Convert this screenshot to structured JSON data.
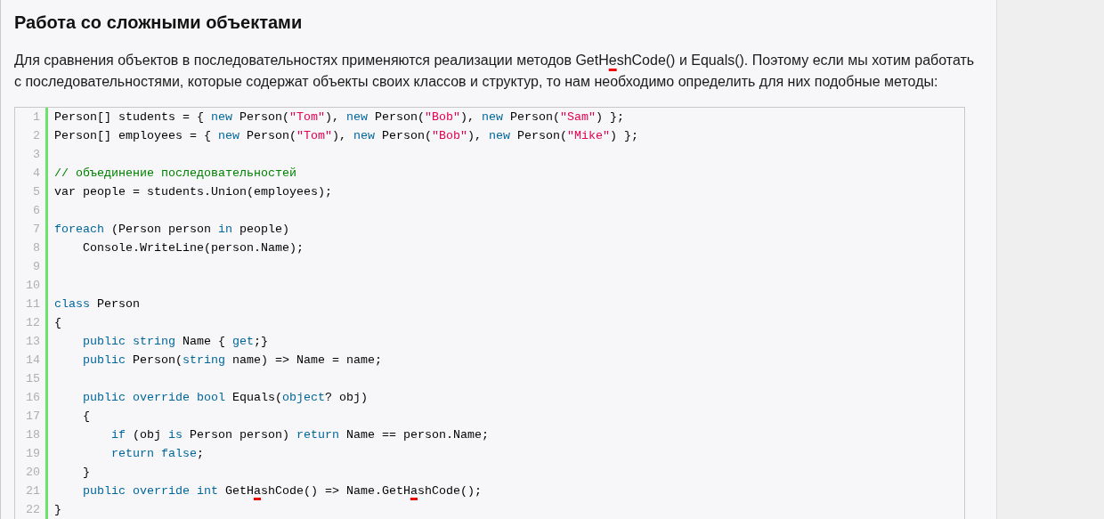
{
  "article": {
    "heading": "Работа со сложными объектами",
    "paragraph": [
      {
        "kind": "plain",
        "text": "Для сравнения объектов в последовательностях применяются реализации методов GetH"
      },
      {
        "kind": "underlined",
        "text": "e"
      },
      {
        "kind": "plain",
        "text": "shCode() и Equals(). Поэтому если мы хотим работать с последовательностями, которые содержат объекты своих классов и структур, то нам необходимо определить для них подобные методы:"
      }
    ],
    "code": [
      {
        "number": "1",
        "tokens": [
          {
            "kind": "plain",
            "text": "Person[] students = { "
          },
          {
            "kind": "keyword",
            "text": "new"
          },
          {
            "kind": "plain",
            "text": " Person("
          },
          {
            "kind": "string",
            "text": "\"Tom\""
          },
          {
            "kind": "plain",
            "text": "), "
          },
          {
            "kind": "keyword",
            "text": "new"
          },
          {
            "kind": "plain",
            "text": " Person("
          },
          {
            "kind": "string",
            "text": "\"Bob\""
          },
          {
            "kind": "plain",
            "text": "), "
          },
          {
            "kind": "keyword",
            "text": "new"
          },
          {
            "kind": "plain",
            "text": " Person("
          },
          {
            "kind": "string",
            "text": "\"Sam\""
          },
          {
            "kind": "plain",
            "text": ") };"
          }
        ]
      },
      {
        "number": "2",
        "tokens": [
          {
            "kind": "plain",
            "text": "Person[] employees = { "
          },
          {
            "kind": "keyword",
            "text": "new"
          },
          {
            "kind": "plain",
            "text": " Person("
          },
          {
            "kind": "string",
            "text": "\"Tom\""
          },
          {
            "kind": "plain",
            "text": "), "
          },
          {
            "kind": "keyword",
            "text": "new"
          },
          {
            "kind": "plain",
            "text": " Person("
          },
          {
            "kind": "string",
            "text": "\"Bob\""
          },
          {
            "kind": "plain",
            "text": "), "
          },
          {
            "kind": "keyword",
            "text": "new"
          },
          {
            "kind": "plain",
            "text": " Person("
          },
          {
            "kind": "string",
            "text": "\"Mike\""
          },
          {
            "kind": "plain",
            "text": ") };"
          }
        ]
      },
      {
        "number": "3"
      },
      {
        "number": "4",
        "tokens": [
          {
            "kind": "comment",
            "text": "// объединение последовательностей"
          }
        ]
      },
      {
        "number": "5",
        "tokens": [
          {
            "kind": "plain",
            "text": "var people = students.Union(employees);"
          }
        ]
      },
      {
        "number": "6"
      },
      {
        "number": "7",
        "tokens": [
          {
            "kind": "keyword",
            "text": "foreach"
          },
          {
            "kind": "plain",
            "text": " (Person person "
          },
          {
            "kind": "keyword",
            "text": "in"
          },
          {
            "kind": "plain",
            "text": " people)"
          }
        ]
      },
      {
        "number": "8",
        "tokens": [
          {
            "kind": "plain",
            "text": "    Console.WriteLine(person.Name);"
          }
        ]
      },
      {
        "number": "9"
      },
      {
        "number": "10"
      },
      {
        "number": "11",
        "tokens": [
          {
            "kind": "keyword",
            "text": "class"
          },
          {
            "kind": "plain",
            "text": " Person"
          }
        ]
      },
      {
        "number": "12",
        "tokens": [
          {
            "kind": "plain",
            "text": "{"
          }
        ]
      },
      {
        "number": "13",
        "tokens": [
          {
            "kind": "keyword",
            "text": "    public string"
          },
          {
            "kind": "plain",
            "text": " Name { "
          },
          {
            "kind": "keyword",
            "text": "get"
          },
          {
            "kind": "plain",
            "text": ";}"
          }
        ]
      },
      {
        "number": "14",
        "tokens": [
          {
            "kind": "keyword",
            "text": "    public"
          },
          {
            "kind": "plain",
            "text": " Person("
          },
          {
            "kind": "keyword",
            "text": "string"
          },
          {
            "kind": "plain",
            "text": " name) => Name = name;"
          }
        ]
      },
      {
        "number": "15"
      },
      {
        "number": "16",
        "tokens": [
          {
            "kind": "keyword",
            "text": "    public override bool"
          },
          {
            "kind": "plain",
            "text": " Equals("
          },
          {
            "kind": "keyword",
            "text": "object"
          },
          {
            "kind": "plain",
            "text": "? obj)"
          }
        ]
      },
      {
        "number": "17",
        "tokens": [
          {
            "kind": "plain",
            "text": "    {"
          }
        ]
      },
      {
        "number": "18",
        "tokens": [
          {
            "kind": "keyword",
            "text": "        if"
          },
          {
            "kind": "plain",
            "text": " (obj "
          },
          {
            "kind": "keyword",
            "text": "is"
          },
          {
            "kind": "plain",
            "text": " Person person) "
          },
          {
            "kind": "keyword",
            "text": "return"
          },
          {
            "kind": "plain",
            "text": " Name == person.Name;"
          }
        ]
      },
      {
        "number": "19",
        "tokens": [
          {
            "kind": "keyword",
            "text": "        return false"
          },
          {
            "kind": "plain",
            "text": ";"
          }
        ]
      },
      {
        "number": "20",
        "tokens": [
          {
            "kind": "plain",
            "text": "    }"
          }
        ]
      },
      {
        "number": "21",
        "tokens": [
          {
            "kind": "keyword",
            "text": "    public override int"
          },
          {
            "kind": "plain",
            "text": " GetH"
          },
          {
            "kind": "underlined",
            "text": "a"
          },
          {
            "kind": "plain",
            "text": "shCode() => Name.GetH"
          },
          {
            "kind": "underlined",
            "text": "a"
          },
          {
            "kind": "plain",
            "text": "shCode();"
          }
        ]
      },
      {
        "number": "22",
        "tokens": [
          {
            "kind": "plain",
            "text": "}"
          }
        ]
      }
    ]
  }
}
